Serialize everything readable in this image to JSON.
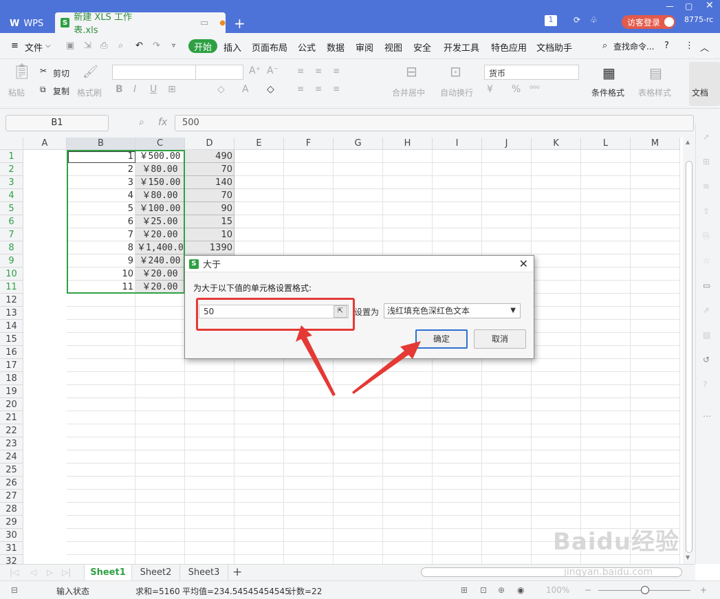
{
  "titlebar": {
    "app_tab": "WPS",
    "file_tab": "新建 XLS 工作表.xls",
    "badge": "1",
    "login": "访客登录",
    "user": "8775-rc"
  },
  "menu": {
    "file": "文件",
    "items": [
      "开始",
      "插入",
      "页面布局",
      "公式",
      "数据",
      "审阅",
      "视图",
      "安全",
      "开发工具",
      "特色应用",
      "文档助手"
    ],
    "search": "查找命令..."
  },
  "ribbon": {
    "paste": "粘贴",
    "cut": "剪切",
    "copy": "复制",
    "format_painter": "格式刷",
    "merge": "合并居中",
    "wrap": "自动换行",
    "number_format": "货币",
    "conditional_format": "条件格式",
    "table_style": "表格样式",
    "doc": "文档"
  },
  "formula_bar": {
    "name_box": "B1",
    "fx": "fx",
    "value": "500"
  },
  "sheet": {
    "columns": [
      "A",
      "B",
      "C",
      "D",
      "E",
      "F",
      "G",
      "H",
      "I",
      "J",
      "K",
      "L",
      "M"
    ],
    "rows": [
      {
        "n": "1",
        "a": "1",
        "b": "￥500.00",
        "c": "490"
      },
      {
        "n": "2",
        "a": "2",
        "b": "￥80.00",
        "c": "70"
      },
      {
        "n": "3",
        "a": "3",
        "b": "￥150.00",
        "c": "140"
      },
      {
        "n": "4",
        "a": "4",
        "b": "￥80.00",
        "c": "70"
      },
      {
        "n": "5",
        "a": "5",
        "b": "￥100.00",
        "c": "90"
      },
      {
        "n": "6",
        "a": "6",
        "b": "￥25.00",
        "c": "15"
      },
      {
        "n": "7",
        "a": "7",
        "b": "￥20.00",
        "c": "10"
      },
      {
        "n": "8",
        "a": "8",
        "b": "￥1,400.00",
        "c": "1390"
      },
      {
        "n": "9",
        "a": "9",
        "b": "￥240.00",
        "c": "230"
      },
      {
        "n": "10",
        "a": "10",
        "b": "￥20.00",
        "c": "10"
      },
      {
        "n": "11",
        "a": "11",
        "b": "￥20.00",
        "c": "10"
      }
    ],
    "empty_rows": [
      "12",
      "13",
      "14",
      "15",
      "16",
      "17",
      "18",
      "19",
      "20",
      "21",
      "22",
      "23",
      "24",
      "25",
      "26",
      "27",
      "28",
      "29",
      "30",
      "31",
      "32"
    ]
  },
  "tabs": [
    "Sheet1",
    "Sheet2",
    "Sheet3"
  ],
  "status": {
    "mode": "输入状态",
    "sum": "求和=5160",
    "avg": "平均值=234.54545454545",
    "count": "计数=22",
    "zoom": "100%"
  },
  "dialog": {
    "title": "大于",
    "prompt": "为大于以下值的单元格设置格式:",
    "input_value": "50",
    "set_label": "设置为",
    "format_option": "浅红填充色深红色文本",
    "ok": "确定",
    "cancel": "取消"
  },
  "watermark": {
    "logo": "Baidu经验",
    "url": "jingyan.baidu.com"
  },
  "colors": {
    "title_bg": "#4e73d8",
    "accent_green": "#2ea043",
    "highlight_red": "#e53935"
  }
}
